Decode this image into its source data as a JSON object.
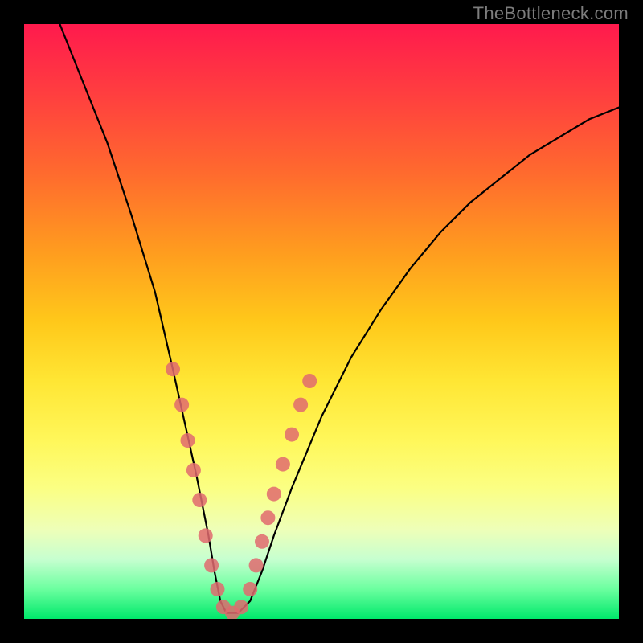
{
  "watermark": "TheBottleneck.com",
  "chart_data": {
    "type": "line",
    "title": "",
    "xlabel": "",
    "ylabel": "",
    "xlim": [
      0,
      100
    ],
    "ylim": [
      0,
      100
    ],
    "series": [
      {
        "name": "bottleneck-curve",
        "x": [
          6,
          10,
          14,
          18,
          22,
          25,
          27,
          29,
          31,
          32,
          33,
          34,
          36,
          38,
          40,
          42,
          45,
          50,
          55,
          60,
          65,
          70,
          75,
          80,
          85,
          90,
          95,
          100
        ],
        "y": [
          100,
          90,
          80,
          68,
          55,
          42,
          33,
          24,
          14,
          8,
          3,
          1,
          1,
          3,
          8,
          14,
          22,
          34,
          44,
          52,
          59,
          65,
          70,
          74,
          78,
          81,
          84,
          86
        ]
      }
    ],
    "highlighted_points": {
      "name": "data-markers",
      "color": "#e06a6f",
      "points": [
        {
          "x": 25.0,
          "y": 42
        },
        {
          "x": 26.5,
          "y": 36
        },
        {
          "x": 27.5,
          "y": 30
        },
        {
          "x": 28.5,
          "y": 25
        },
        {
          "x": 29.5,
          "y": 20
        },
        {
          "x": 30.5,
          "y": 14
        },
        {
          "x": 31.5,
          "y": 9
        },
        {
          "x": 32.5,
          "y": 5
        },
        {
          "x": 33.5,
          "y": 2
        },
        {
          "x": 35.0,
          "y": 1
        },
        {
          "x": 36.5,
          "y": 2
        },
        {
          "x": 38.0,
          "y": 5
        },
        {
          "x": 39.0,
          "y": 9
        },
        {
          "x": 40.0,
          "y": 13
        },
        {
          "x": 41.0,
          "y": 17
        },
        {
          "x": 42.0,
          "y": 21
        },
        {
          "x": 43.5,
          "y": 26
        },
        {
          "x": 45.0,
          "y": 31
        },
        {
          "x": 46.5,
          "y": 36
        },
        {
          "x": 48.0,
          "y": 40
        }
      ]
    },
    "gradient_stops": [
      {
        "pos": 0,
        "color": "#ff1a4d"
      },
      {
        "pos": 50,
        "color": "#ffc81a"
      },
      {
        "pos": 78,
        "color": "#fbff83"
      },
      {
        "pos": 100,
        "color": "#00e86b"
      }
    ]
  }
}
